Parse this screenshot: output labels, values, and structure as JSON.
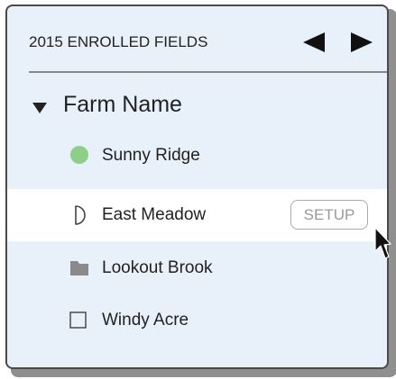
{
  "header": {
    "title": "2015 ENROLLED FIELDS",
    "prev_icon": "triangle-left-icon",
    "next_icon": "triangle-right-icon"
  },
  "group": {
    "label": "Farm Name",
    "expanded": true,
    "icon": "caret-down-icon"
  },
  "fields": [
    {
      "label": "Sunny Ridge",
      "icon": "green-circle-icon",
      "icon_color": "#8ecf87",
      "selected": false
    },
    {
      "label": "East Meadow",
      "icon": "half-circle-outline-icon",
      "selected": true,
      "action_label": "SETUP"
    },
    {
      "label": "Lookout Brook",
      "icon": "gray-folder-icon",
      "icon_color": "#8a8a8a",
      "selected": false
    },
    {
      "label": "Windy Acre",
      "icon": "square-outline-icon",
      "selected": false
    }
  ],
  "colors": {
    "panel_background": "#e8f0fa",
    "selected_row": "#ffffff",
    "border": "#4a4a4a",
    "shadow": "#8f8f8f"
  }
}
